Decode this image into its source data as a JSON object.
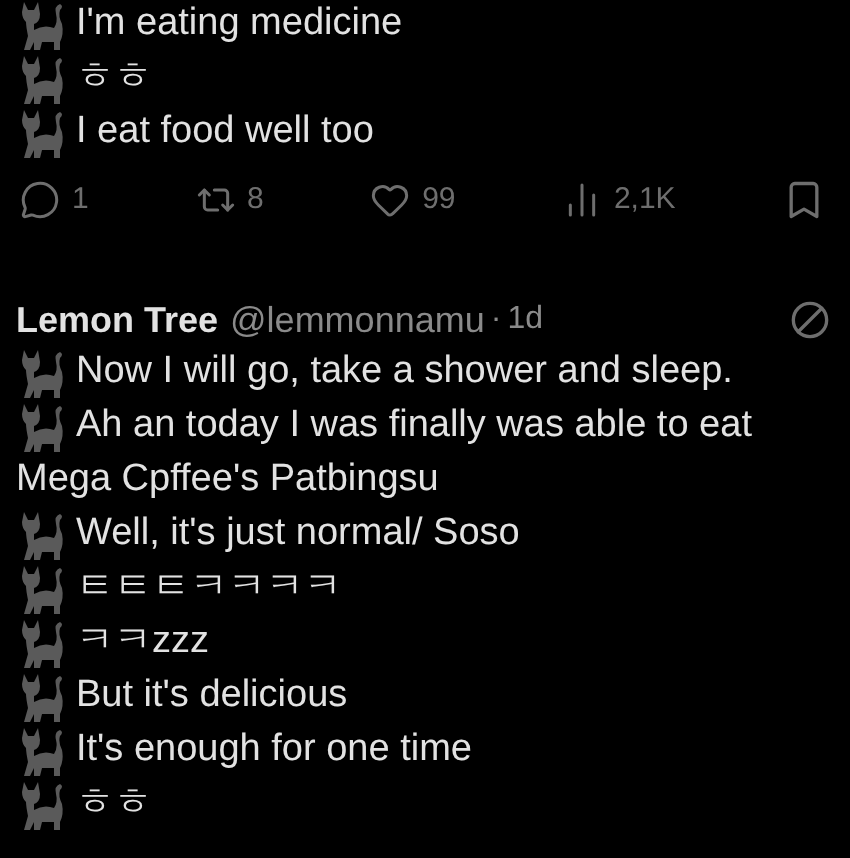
{
  "previous_tweet": {
    "lines": [
      {
        "text": "I'm eating medicine",
        "cat": true
      },
      {
        "text": "ㅎㅎ",
        "cat": true
      },
      {
        "text": "I eat food well too",
        "cat": true
      }
    ],
    "actions": {
      "replies": "1",
      "reposts": "8",
      "likes": "99",
      "views": "2,1K"
    }
  },
  "tweet": {
    "name": "Lemon Tree",
    "handle": "@lemmonnamu",
    "separator": "·",
    "time": "1d",
    "muted": true,
    "lines": [
      {
        "text": "Now I will go, take a shower and sleep.",
        "cat": true
      },
      {
        "text": "Ah an today I was finally was able to eat",
        "cat": true
      },
      {
        "text": "Mega Cpffee's Patbingsu",
        "cat": false
      },
      {
        "text": "Well, it's just normal/ Soso",
        "cat": true
      },
      {
        "text": "ㅌㅌㅌㅋㅋㅋㅋ",
        "cat": true
      },
      {
        "text": "ㅋㅋzzz",
        "cat": true
      },
      {
        "text": "But it's delicious",
        "cat": true
      },
      {
        "text": "It's enough for one time",
        "cat": true
      },
      {
        "text": "ㅎㅎ",
        "cat": true
      }
    ]
  }
}
